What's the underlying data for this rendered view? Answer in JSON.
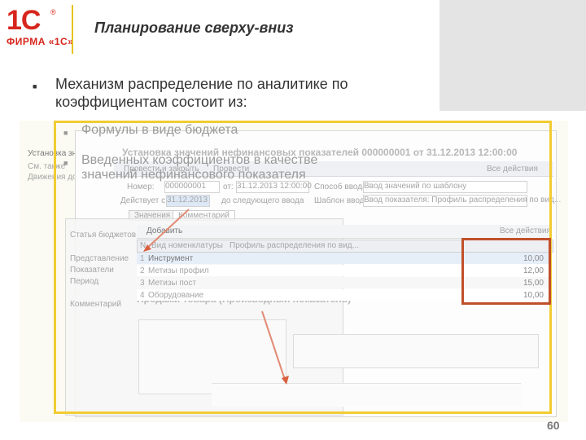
{
  "header": {
    "logo_text": "1С",
    "logo_reg": "®",
    "logo_firm": "ФИРМА «1С»",
    "title": "Планирование сверху-вниз"
  },
  "bullets": [
    {
      "marker": "■",
      "text": "Механизм распределение по аналитике по коэффициентам состоит из:"
    },
    {
      "marker": "■",
      "text": "Формулы в виде бюджета"
    },
    {
      "marker": "■",
      "text": "Введенных коэффициентов в качестве значений нефинансового показателя"
    }
  ],
  "screenshot": {
    "window_title": "Установка значений нефинансовых показателей 000000001 от 31.12.2013 12:00:00",
    "left_nav": [
      "Установка значений",
      "См. также",
      "Движения документ"
    ],
    "toolbar": [
      "Провести и закрыть",
      "Провести",
      "Все действия"
    ],
    "number_label": "Номер:",
    "number_value": "000000001",
    "from_label": "от:",
    "date_value": "31.12.2013 12:00:00",
    "input_label": "Способ ввода:",
    "input_value": "Ввод значений по шаблону",
    "valid_label": "Действует с:",
    "valid_value": "31.12.2013",
    "until_label": "до следующего ввода",
    "template_label": "Шаблон ввода:",
    "template_value": "Ввод показателя: Профиль распределения по вид...",
    "tabs": [
      "Значения",
      "Комментарий"
    ],
    "add_button": "Добавить",
    "all_actions": "Все действия",
    "table_headers": [
      "N",
      "Вид номенклатуры",
      "Профиль распределения по вид..."
    ],
    "rows": [
      {
        "n": "1",
        "name": "Инструмент",
        "value": "10,00"
      },
      {
        "n": "2",
        "name": "Метизы профил",
        "value": "12,00"
      },
      {
        "n": "3",
        "name": "Метизы пост",
        "value": "15,00"
      },
      {
        "n": "4",
        "name": "Оборудование",
        "value": "10,00"
      }
    ],
    "bg_window": "Продажи товара (Производный показатель)",
    "bg_labels": [
      "Статья бюджетов",
      "Представление",
      "Показатели",
      "Период",
      "Комментарий"
    ]
  },
  "page_number": "60"
}
